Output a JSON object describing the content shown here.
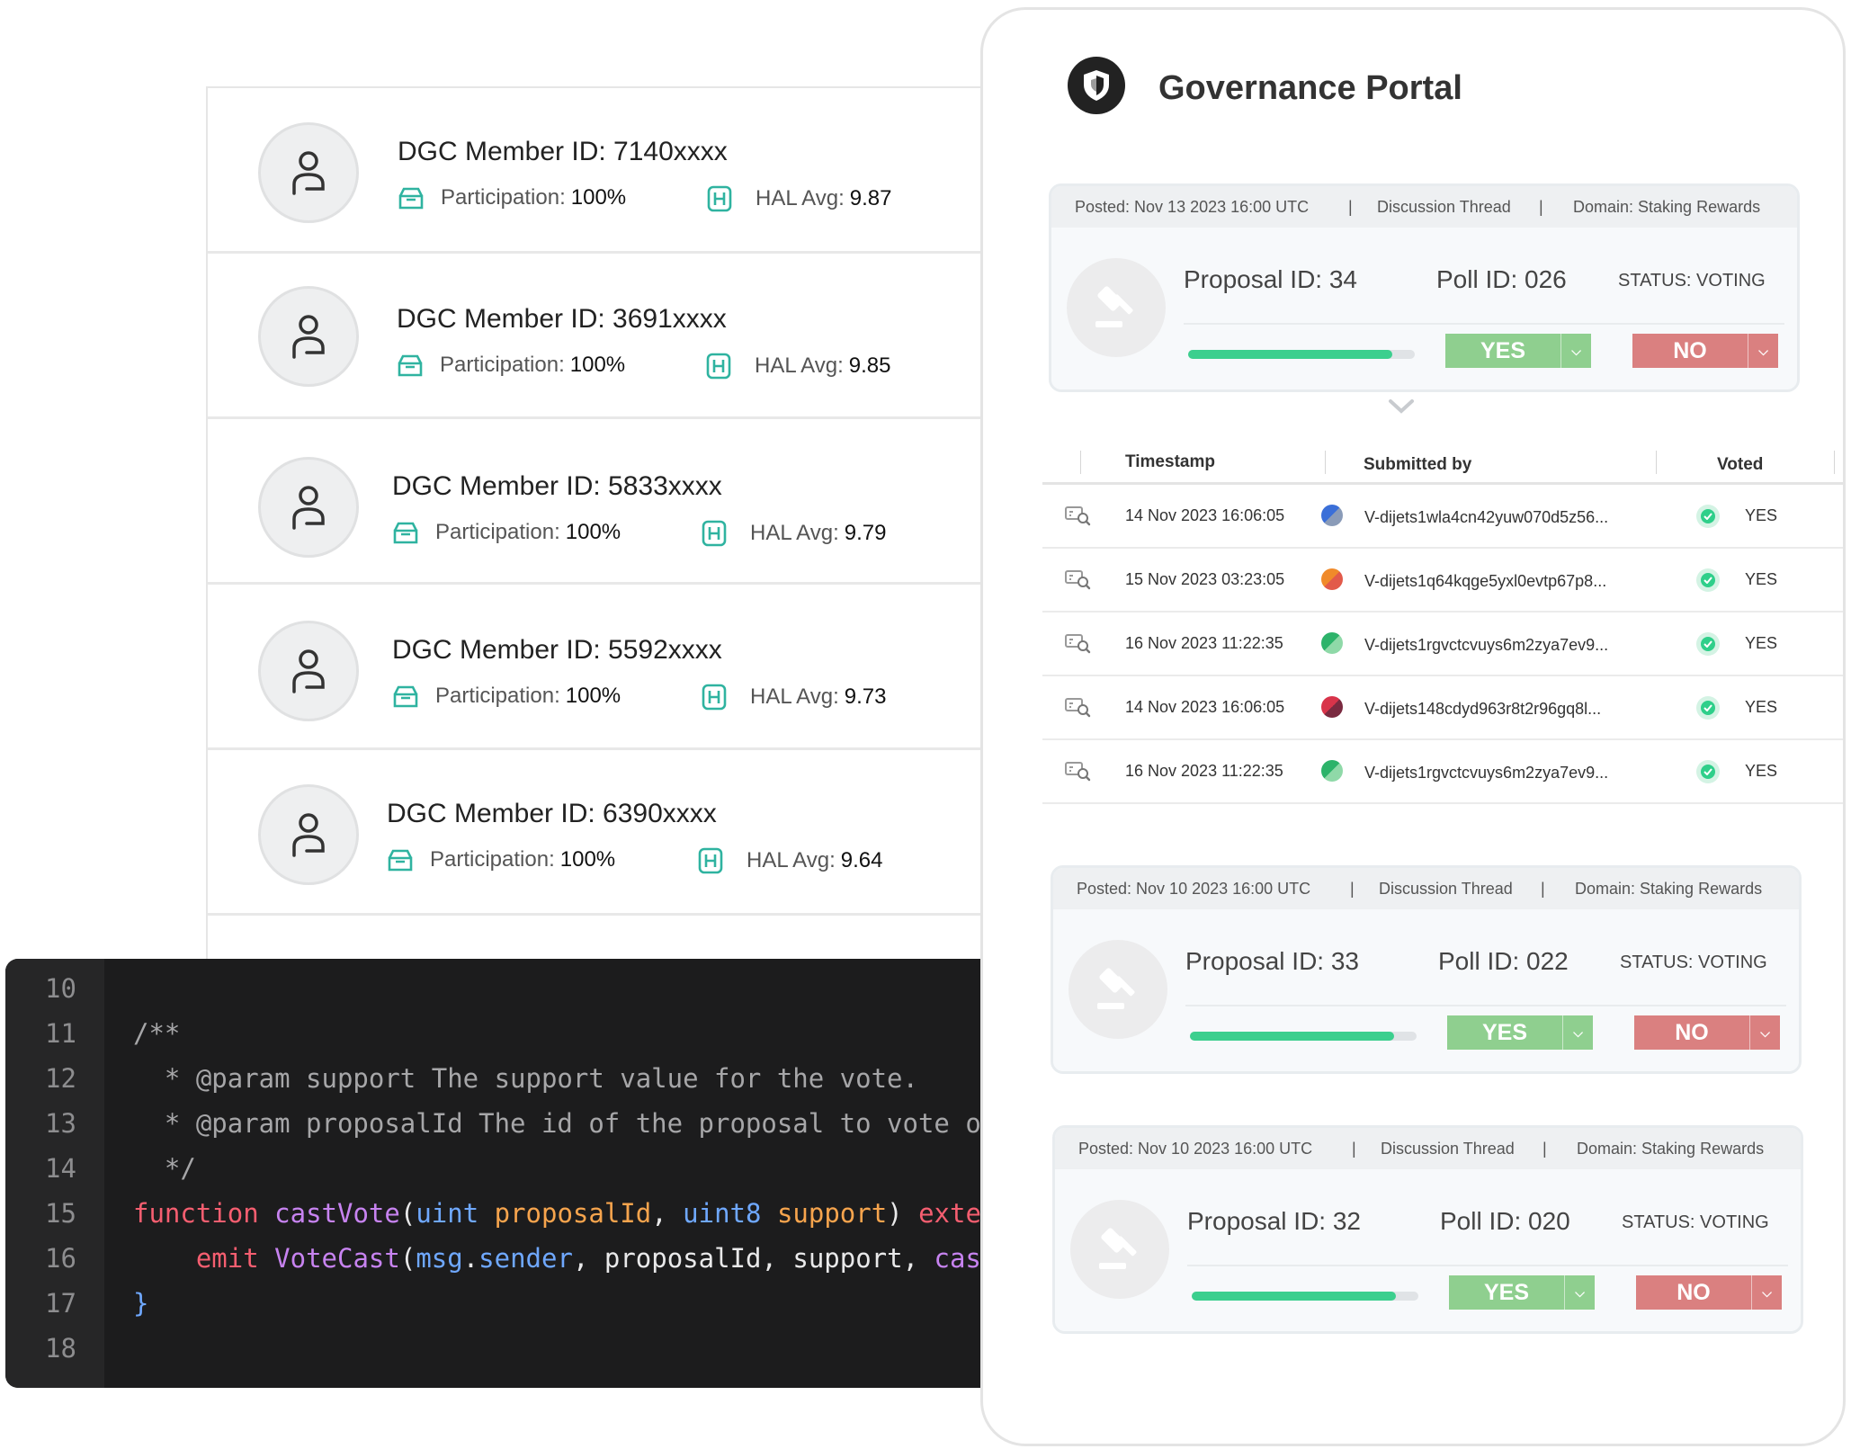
{
  "members": [
    {
      "title": "DGC Member ID: 7140xxxx",
      "participation_label": "Participation:",
      "participation": "100%",
      "hal_label": "HAL Avg:",
      "hal": "9.87"
    },
    {
      "title": "DGC Member ID: 3691xxxx",
      "participation_label": "Participation:",
      "participation": "100%",
      "hal_label": "HAL Avg:",
      "hal": "9.85"
    },
    {
      "title": "DGC Member ID: 5833xxxx",
      "participation_label": "Participation:",
      "participation": "100%",
      "hal_label": "HAL Avg:",
      "hal": "9.79"
    },
    {
      "title": "DGC Member ID: 5592xxxx",
      "participation_label": "Participation:",
      "participation": "100%",
      "hal_label": "HAL Avg:",
      "hal": "9.73"
    },
    {
      "title": "DGC Member ID: 6390xxxx",
      "participation_label": "Participation:",
      "participation": "100%",
      "hal_label": "HAL Avg:",
      "hal": "9.64"
    }
  ],
  "icons": {
    "member_avatar": "user-icon",
    "participation": "ballot-box-icon",
    "hal": "hal-badge-icon",
    "portal_logo": "shield-icon",
    "proposal": "gavel-icon",
    "row_view": "search-log-icon",
    "voted": "check-circle-icon",
    "expand": "chevron-down-icon"
  },
  "code": {
    "lines": [
      {
        "n": "10"
      },
      {
        "n": "11",
        "parts": [
          {
            "t": "/**",
            "c": "c-com"
          }
        ]
      },
      {
        "n": "12",
        "parts": [
          {
            "t": "  * @param support The support value for the vote.",
            "c": "c-com"
          }
        ]
      },
      {
        "n": "13",
        "parts": [
          {
            "t": "  * @param proposalId The id of the proposal to vote on",
            "c": "c-com"
          }
        ]
      },
      {
        "n": "14",
        "parts": [
          {
            "t": "  */",
            "c": "c-com"
          }
        ]
      },
      {
        "n": "15",
        "parts": [
          {
            "t": "function",
            "c": "c-kw"
          },
          {
            "t": " ",
            "c": "c-id"
          },
          {
            "t": "castVote",
            "c": "c-fn"
          },
          {
            "t": "(",
            "c": "c-id"
          },
          {
            "t": "uint",
            "c": "c-ty"
          },
          {
            "t": " ",
            "c": "c-id"
          },
          {
            "t": "proposalId",
            "c": "c-par"
          },
          {
            "t": ", ",
            "c": "c-id"
          },
          {
            "t": "uint8",
            "c": "c-ty"
          },
          {
            "t": " ",
            "c": "c-id"
          },
          {
            "t": "support",
            "c": "c-par"
          },
          {
            "t": ") ",
            "c": "c-id"
          },
          {
            "t": "exte",
            "c": "c-kw"
          }
        ]
      },
      {
        "n": "16",
        "parts": [
          {
            "t": "    emit",
            "c": "c-kw"
          },
          {
            "t": " ",
            "c": "c-id"
          },
          {
            "t": "VoteCast",
            "c": "c-fn"
          },
          {
            "t": "(",
            "c": "c-id"
          },
          {
            "t": "msg",
            "c": "c-ty"
          },
          {
            "t": ".",
            "c": "c-id"
          },
          {
            "t": "sender",
            "c": "c-ty"
          },
          {
            "t": ", proposalId, support, ",
            "c": "c-id"
          },
          {
            "t": "cas",
            "c": "c-fn"
          }
        ]
      },
      {
        "n": "17",
        "parts": [
          {
            "t": "}",
            "c": "c-br"
          }
        ]
      },
      {
        "n": "18"
      }
    ]
  },
  "portal": {
    "title": "Governance Portal",
    "proposals": [
      {
        "posted": "Posted: Nov 13 2023 16:00 UTC",
        "sep": "|",
        "thread": "Discussion Thread",
        "domain": "Domain: Staking Rewards",
        "proposal_id": "Proposal ID: 34",
        "poll_id": "Poll ID: 026",
        "status": "STATUS: VOTING",
        "progress": 0.9,
        "yes": "YES",
        "no": "NO"
      },
      {
        "posted": "Posted: Nov 10 2023 16:00 UTC",
        "sep": "|",
        "thread": "Discussion Thread",
        "domain": "Domain: Staking Rewards",
        "proposal_id": "Proposal ID: 33",
        "poll_id": "Poll ID: 022",
        "status": "STATUS: VOTING",
        "progress": 0.9,
        "yes": "YES",
        "no": "NO"
      },
      {
        "posted": "Posted: Nov 10 2023 16:00 UTC",
        "sep": "|",
        "thread": "Discussion Thread",
        "domain": "Domain: Staking Rewards",
        "proposal_id": "Proposal ID: 32",
        "poll_id": "Poll ID: 020",
        "status": "STATUS: VOTING",
        "progress": 0.9,
        "yes": "YES",
        "no": "NO"
      }
    ],
    "votes": {
      "headers": {
        "timestamp": "Timestamp",
        "submitted_by": "Submitted by",
        "voted": "Voted"
      },
      "rows": [
        {
          "timestamp": "14 Nov 2023 16:06:05",
          "submitter": "V-dijets1wla4cn42yuw070d5z56...",
          "vote": "YES",
          "color_a": "#3b6fd8",
          "color_b": "#8a9bb8"
        },
        {
          "timestamp": "15 Nov 2023 03:23:05",
          "submitter": "V-dijets1q64kqge5yxl0evtp67p8...",
          "vote": "YES",
          "color_a": "#f08a2a",
          "color_b": "#e25a4a"
        },
        {
          "timestamp": "16 Nov 2023 11:22:35",
          "submitter": "V-dijets1rgvctcvuys6m2zya7ev9...",
          "vote": "YES",
          "color_a": "#2db36a",
          "color_b": "#8fd9a8"
        },
        {
          "timestamp": "14 Nov 2023 16:06:05",
          "submitter": "V-dijets148cdyd963r8t2r96gq8l...",
          "vote": "YES",
          "color_a": "#d8344a",
          "color_b": "#7a2a40"
        },
        {
          "timestamp": "16 Nov 2023 11:22:35",
          "submitter": "V-dijets1rgvctcvuys6m2zya7ev9...",
          "vote": "YES",
          "color_a": "#2db36a",
          "color_b": "#8fd9a8"
        }
      ]
    }
  }
}
